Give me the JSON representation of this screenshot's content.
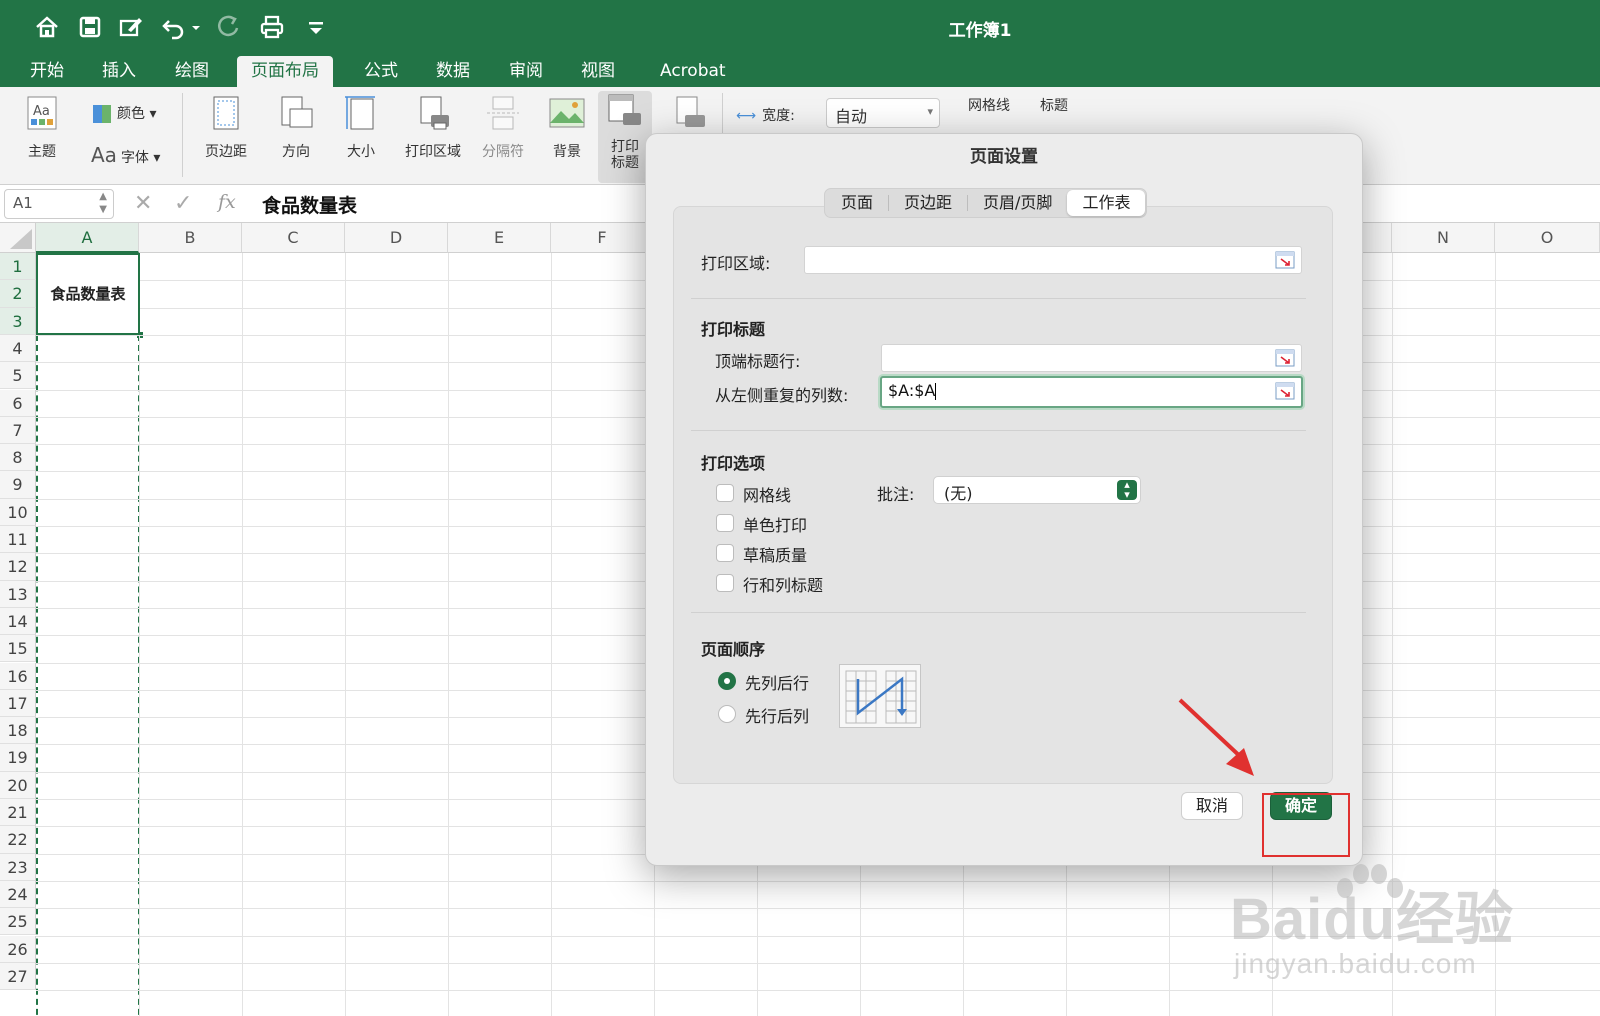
{
  "window": {
    "title": "工作簿1"
  },
  "ribbon_tabs": [
    "开始",
    "插入",
    "绘图",
    "页面布局",
    "公式",
    "数据",
    "审阅",
    "视图",
    "Acrobat"
  ],
  "active_tab_index": 3,
  "ribbon": {
    "theme": "主题",
    "colors": "颜色",
    "fonts": "字体",
    "margins": "页边距",
    "orientation": "方向",
    "size": "大小",
    "print_area": "打印区域",
    "breaks": "分隔符",
    "background": "背景",
    "print_titles_line1": "打印",
    "print_titles_line2": "标题",
    "width_label": "宽度:",
    "width_value": "自动",
    "gridlines": "网格线",
    "headings": "标题"
  },
  "formula_bar": {
    "cell_ref": "A1",
    "fx": "fx",
    "content": "食品数量表"
  },
  "sheet": {
    "columns": [
      "A",
      "B",
      "C",
      "D",
      "E",
      "F",
      "N",
      "O"
    ],
    "rows": [
      "1",
      "2",
      "3",
      "4",
      "5",
      "6",
      "7",
      "8",
      "9",
      "10",
      "11",
      "12",
      "13",
      "14",
      "15",
      "16",
      "17",
      "18",
      "19",
      "20",
      "21",
      "22",
      "23",
      "24",
      "25",
      "26",
      "27"
    ],
    "cell_a1": "食品数量表"
  },
  "dialog": {
    "title": "页面设置",
    "tabs": [
      "页面",
      "页边距",
      "页眉/页脚",
      "工作表"
    ],
    "active_tab_index": 3,
    "print_area_label": "打印区域:",
    "print_area_value": "",
    "print_titles_section": "打印标题",
    "rows_to_repeat_label": "顶端标题行:",
    "rows_to_repeat_value": "",
    "cols_to_repeat_label": "从左侧重复的列数:",
    "cols_to_repeat_value": "$A:$A",
    "print_section": "打印选项",
    "options": [
      {
        "label": "网格线",
        "checked": false
      },
      {
        "label": "单色打印",
        "checked": false
      },
      {
        "label": "草稿质量",
        "checked": false
      },
      {
        "label": "行和列标题",
        "checked": false
      }
    ],
    "comments_label": "批注:",
    "comments_value": "(无)",
    "page_order_section": "页面顺序",
    "page_order_options": [
      {
        "label": "先列后行",
        "selected": true
      },
      {
        "label": "先行后列",
        "selected": false
      }
    ],
    "cancel": "取消",
    "ok": "确定"
  },
  "watermark": {
    "main": "Baidu经验",
    "sub": "jingyan.baidu.com"
  },
  "colors": {
    "excel_green": "#227446",
    "highlight_red": "#e0312f"
  }
}
